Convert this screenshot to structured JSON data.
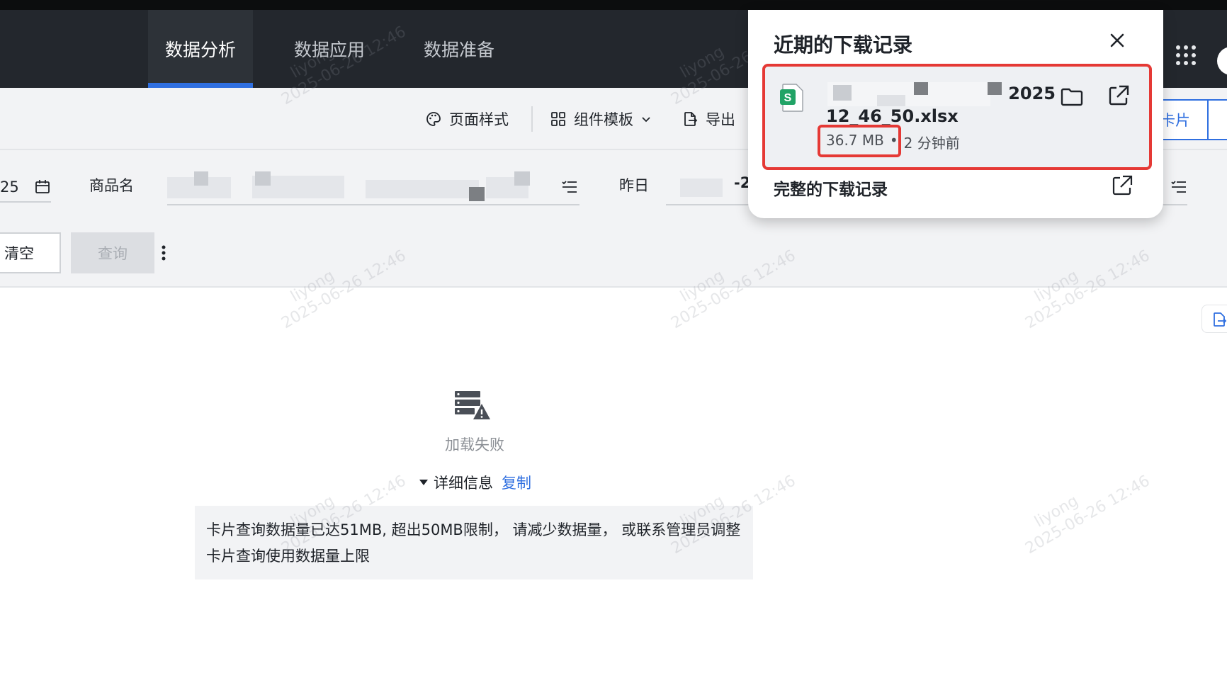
{
  "topnav": {
    "tabs": [
      {
        "label": "数据分析",
        "active": true
      },
      {
        "label": "数据应用",
        "active": false
      },
      {
        "label": "数据准备",
        "active": false
      }
    ],
    "apps_icon": "grid-dots-icon"
  },
  "toolbar": {
    "page_style": "页面样式",
    "component_template": "组件模板",
    "export": "导出",
    "card_partial": "卡片"
  },
  "filters": {
    "date_partial": "25",
    "product_name_label": "商品名",
    "yesterday_label": "昨日",
    "yesterday_value_partial": "-2",
    "clear_button": "清空",
    "query_button": "查询"
  },
  "error": {
    "title": "加载失败",
    "detail_label": "详细信息",
    "copy_link": "复制",
    "message": "卡片查询数据量已达51MB, 超出50MB限制， 请减少数据量， 或联系管理员调整卡片查询使用数据量上限"
  },
  "watermark": {
    "user": "liyong",
    "time": "2025-06-26 12:46"
  },
  "downloads": {
    "title": "近期的下载记录",
    "item": {
      "name_line1_visible": "2025",
      "name_line2": "12_46_50.xlsx",
      "size": "36.7 MB",
      "separator": "•",
      "time_ago": "2 分钟前",
      "file_icon_letter": "S"
    },
    "full_history": "完整的下载记录"
  },
  "colors": {
    "accent": "#2f6fe0",
    "highlight": "#e53935",
    "nav_bg": "#23272d",
    "sheet_green": "#21a366"
  }
}
